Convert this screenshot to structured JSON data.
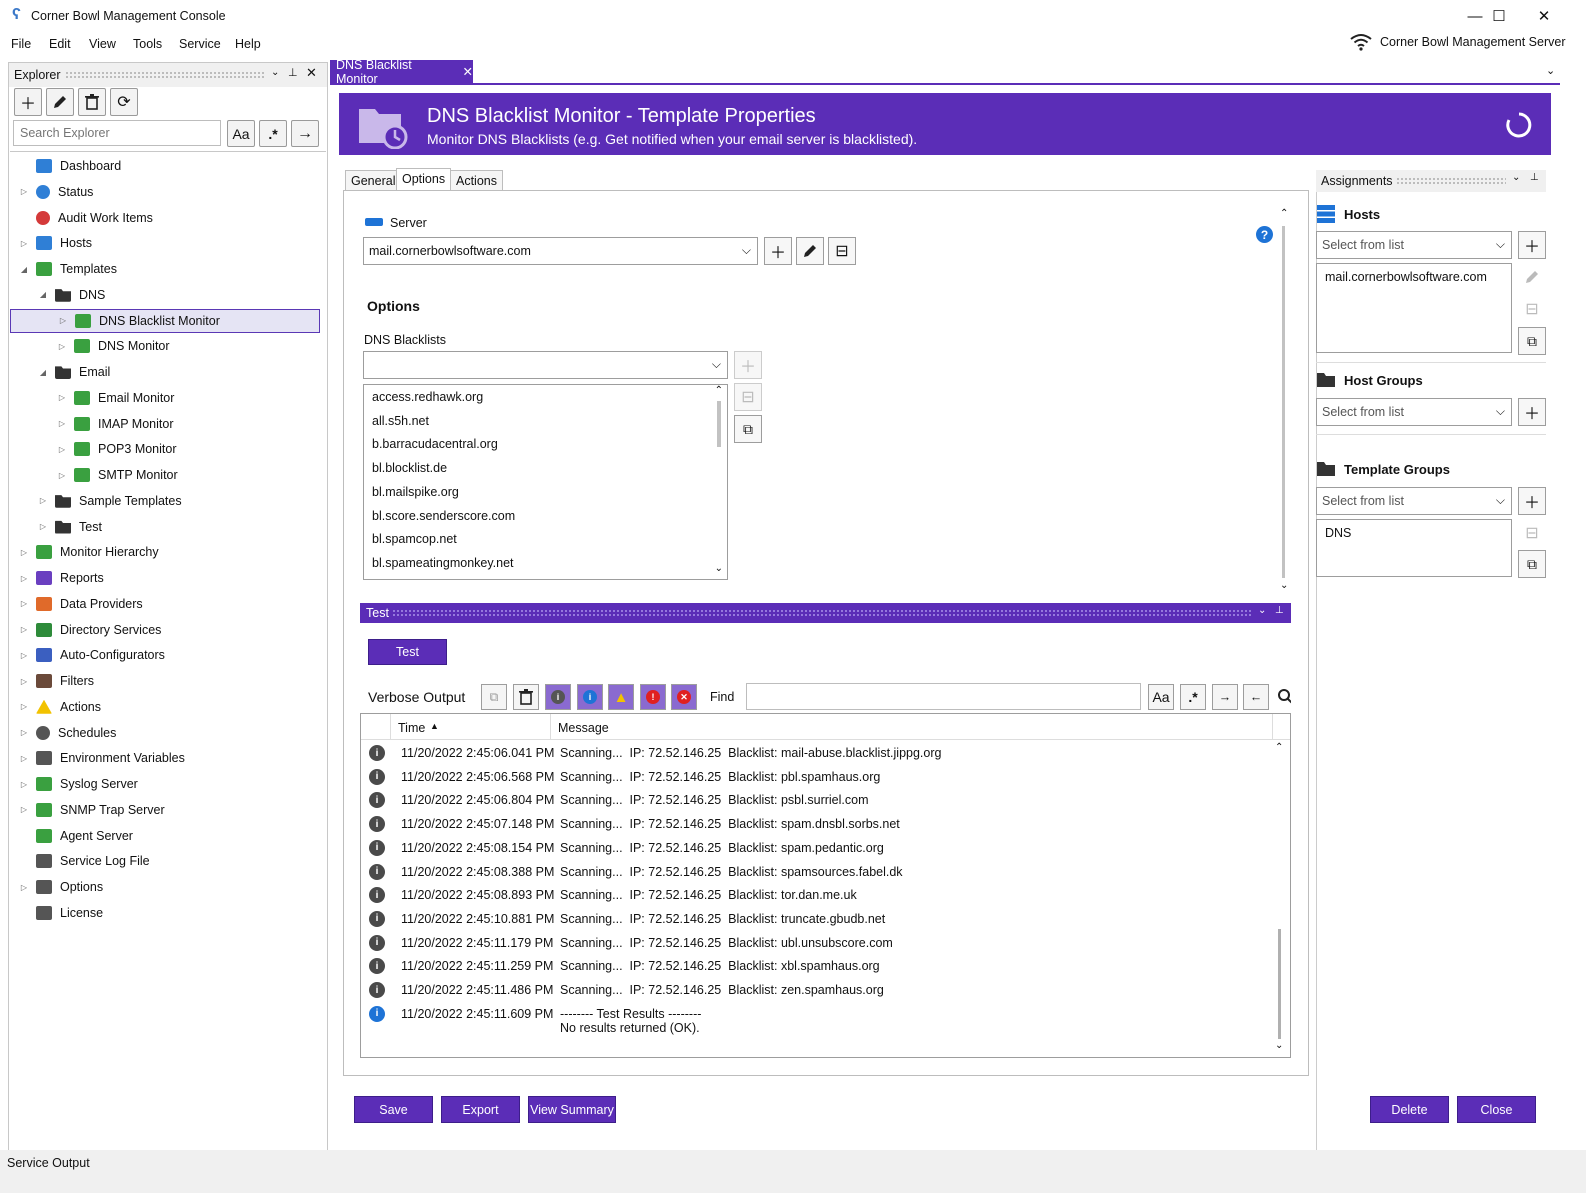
{
  "window": {
    "title": "Corner Bowl Management Console",
    "server_label": "Corner Bowl Management Server"
  },
  "menu": [
    "File",
    "Edit",
    "View",
    "Tools",
    "Service",
    "Help"
  ],
  "explorer": {
    "title": "Explorer",
    "search_placeholder": "Search Explorer",
    "case_label": "Aa",
    "regex_label": ".*",
    "tree": [
      {
        "label": "Dashboard",
        "level": 0,
        "arrow": "",
        "icon": "dashboard-icon",
        "color": "#2f7fd6"
      },
      {
        "label": "Status",
        "level": 0,
        "arrow": "▷",
        "icon": "info-icon",
        "color": "#2f7fd6"
      },
      {
        "label": "Audit Work Items",
        "level": 0,
        "arrow": "",
        "icon": "shield-icon",
        "color": "#d43a3a"
      },
      {
        "label": "Hosts",
        "level": 0,
        "arrow": "▷",
        "icon": "server-icon",
        "color": "#2f7fd6"
      },
      {
        "label": "Templates",
        "level": 0,
        "arrow": "◢",
        "icon": "template-icon",
        "color": "#3aa040"
      },
      {
        "label": "DNS",
        "level": 1,
        "arrow": "◢",
        "icon": "folder-open-icon",
        "color": "#333"
      },
      {
        "label": "DNS Blacklist Monitor",
        "level": 2,
        "arrow": "▷",
        "icon": "monitor-template-icon",
        "color": "#3aa040",
        "selected": true
      },
      {
        "label": "DNS Monitor",
        "level": 2,
        "arrow": "▷",
        "icon": "monitor-template-icon",
        "color": "#3aa040"
      },
      {
        "label": "Email",
        "level": 1,
        "arrow": "◢",
        "icon": "folder-open-icon",
        "color": "#333"
      },
      {
        "label": "Email Monitor",
        "level": 2,
        "arrow": "▷",
        "icon": "monitor-template-icon",
        "color": "#3aa040"
      },
      {
        "label": "IMAP Monitor",
        "level": 2,
        "arrow": "▷",
        "icon": "monitor-template-icon",
        "color": "#3aa040"
      },
      {
        "label": "POP3 Monitor",
        "level": 2,
        "arrow": "▷",
        "icon": "monitor-template-icon",
        "color": "#3aa040"
      },
      {
        "label": "SMTP Monitor",
        "level": 2,
        "arrow": "▷",
        "icon": "monitor-template-icon",
        "color": "#3aa040"
      },
      {
        "label": "Sample Templates",
        "level": 1,
        "arrow": "▷",
        "icon": "folder-icon",
        "color": "#333"
      },
      {
        "label": "Test",
        "level": 1,
        "arrow": "▷",
        "icon": "folder-icon",
        "color": "#333"
      },
      {
        "label": "Monitor Hierarchy",
        "level": 0,
        "arrow": "▷",
        "icon": "hierarchy-icon",
        "color": "#3aa040"
      },
      {
        "label": "Reports",
        "level": 0,
        "arrow": "▷",
        "icon": "chart-icon",
        "color": "#6a3fc0"
      },
      {
        "label": "Data Providers",
        "level": 0,
        "arrow": "▷",
        "icon": "database-icon",
        "color": "#e06a2a"
      },
      {
        "label": "Directory Services",
        "level": 0,
        "arrow": "▷",
        "icon": "tree-icon",
        "color": "#2e8b3a"
      },
      {
        "label": "Auto-Configurators",
        "level": 0,
        "arrow": "▷",
        "icon": "puzzle-icon",
        "color": "#3b5fc0"
      },
      {
        "label": "Filters",
        "level": 0,
        "arrow": "▷",
        "icon": "filter-icon",
        "color": "#6b4a3a"
      },
      {
        "label": "Actions",
        "level": 0,
        "arrow": "▷",
        "icon": "warning-icon",
        "color": "#f2c200"
      },
      {
        "label": "Schedules",
        "level": 0,
        "arrow": "▷",
        "icon": "clock-icon",
        "color": "#555"
      },
      {
        "label": "Environment Variables",
        "level": 0,
        "arrow": "▷",
        "icon": "variable-icon",
        "color": "#555"
      },
      {
        "label": "Syslog Server",
        "level": 0,
        "arrow": "▷",
        "icon": "syslog-icon",
        "color": "#3aa040"
      },
      {
        "label": "SNMP Trap Server",
        "level": 0,
        "arrow": "▷",
        "icon": "snmp-icon",
        "color": "#3aa040"
      },
      {
        "label": "Agent Server",
        "level": 0,
        "arrow": "",
        "icon": "upload-icon",
        "color": "#3aa040"
      },
      {
        "label": "Service Log File",
        "level": 0,
        "arrow": "",
        "icon": "log-file-icon",
        "color": "#555"
      },
      {
        "label": "Options",
        "level": 0,
        "arrow": "▷",
        "icon": "gear-icon",
        "color": "#555"
      },
      {
        "label": "License",
        "level": 0,
        "arrow": "",
        "icon": "key-icon",
        "color": "#555"
      }
    ]
  },
  "doc_tab": {
    "label": "DNS Blacklist Monitor"
  },
  "banner": {
    "title": "DNS Blacklist Monitor - Template Properties",
    "subtitle": "Monitor DNS Blacklists (e.g. Get notified when your email server is blacklisted)."
  },
  "prop_tabs": [
    "General",
    "Options",
    "Actions"
  ],
  "server": {
    "label": "Server",
    "value": "mail.cornerbowlsoftware.com"
  },
  "options": {
    "heading": "Options",
    "blacklists_label": "DNS Blacklists",
    "blacklists": [
      "access.redhawk.org",
      "all.s5h.net",
      "b.barracudacentral.org",
      "bl.blocklist.de",
      "bl.mailspike.org",
      "bl.score.senderscore.com",
      "bl.spamcop.net",
      "bl.spameatingmonkey.net"
    ]
  },
  "test": {
    "header": "Test",
    "button": "Test",
    "verbose_label": "Verbose Output",
    "find_label": "Find",
    "find_value": "",
    "case_label": "Aa",
    "regex_label": ".*",
    "columns": [
      "Time",
      "Message"
    ],
    "rows": [
      {
        "time": "11/20/2022 2:45:06.041 PM",
        "msg": "Scanning...  IP: 72.52.146.25  Blacklist: mail-abuse.blacklist.jippg.org",
        "type": "info"
      },
      {
        "time": "11/20/2022 2:45:06.568 PM",
        "msg": "Scanning...  IP: 72.52.146.25  Blacklist: pbl.spamhaus.org",
        "type": "info"
      },
      {
        "time": "11/20/2022 2:45:06.804 PM",
        "msg": "Scanning...  IP: 72.52.146.25  Blacklist: psbl.surriel.com",
        "type": "info"
      },
      {
        "time": "11/20/2022 2:45:07.148 PM",
        "msg": "Scanning...  IP: 72.52.146.25  Blacklist: spam.dnsbl.sorbs.net",
        "type": "info"
      },
      {
        "time": "11/20/2022 2:45:08.154 PM",
        "msg": "Scanning...  IP: 72.52.146.25  Blacklist: spam.pedantic.org",
        "type": "info"
      },
      {
        "time": "11/20/2022 2:45:08.388 PM",
        "msg": "Scanning...  IP: 72.52.146.25  Blacklist: spamsources.fabel.dk",
        "type": "info"
      },
      {
        "time": "11/20/2022 2:45:08.893 PM",
        "msg": "Scanning...  IP: 72.52.146.25  Blacklist: tor.dan.me.uk",
        "type": "info"
      },
      {
        "time": "11/20/2022 2:45:10.881 PM",
        "msg": "Scanning...  IP: 72.52.146.25  Blacklist: truncate.gbudb.net",
        "type": "info"
      },
      {
        "time": "11/20/2022 2:45:11.179 PM",
        "msg": "Scanning...  IP: 72.52.146.25  Blacklist: ubl.unsubscore.com",
        "type": "info"
      },
      {
        "time": "11/20/2022 2:45:11.259 PM",
        "msg": "Scanning...  IP: 72.52.146.25  Blacklist: xbl.spamhaus.org",
        "type": "info"
      },
      {
        "time": "11/20/2022 2:45:11.486 PM",
        "msg": "Scanning...  IP: 72.52.146.25  Blacklist: zen.spamhaus.org",
        "type": "info"
      },
      {
        "time": "11/20/2022 2:45:11.609 PM",
        "msg": "-------- Test Results --------",
        "msg2": "No results returned (OK).",
        "type": "result"
      }
    ]
  },
  "footer": {
    "save": "Save",
    "export": "Export",
    "view_summary": "View Summary",
    "delete": "Delete",
    "close": "Close"
  },
  "assignments": {
    "title": "Assignments",
    "hosts_title": "Hosts",
    "host_groups_title": "Host Groups",
    "template_groups_title": "Template Groups",
    "select_placeholder": "Select from list",
    "hosts": [
      "mail.cornerbowlsoftware.com"
    ],
    "template_groups": [
      "DNS"
    ]
  },
  "status_bar": {
    "label": "Service Output"
  },
  "colors": {
    "accent": "#5b2db7",
    "info": "#4a4a4a",
    "info_blue": "#1e73d6"
  }
}
